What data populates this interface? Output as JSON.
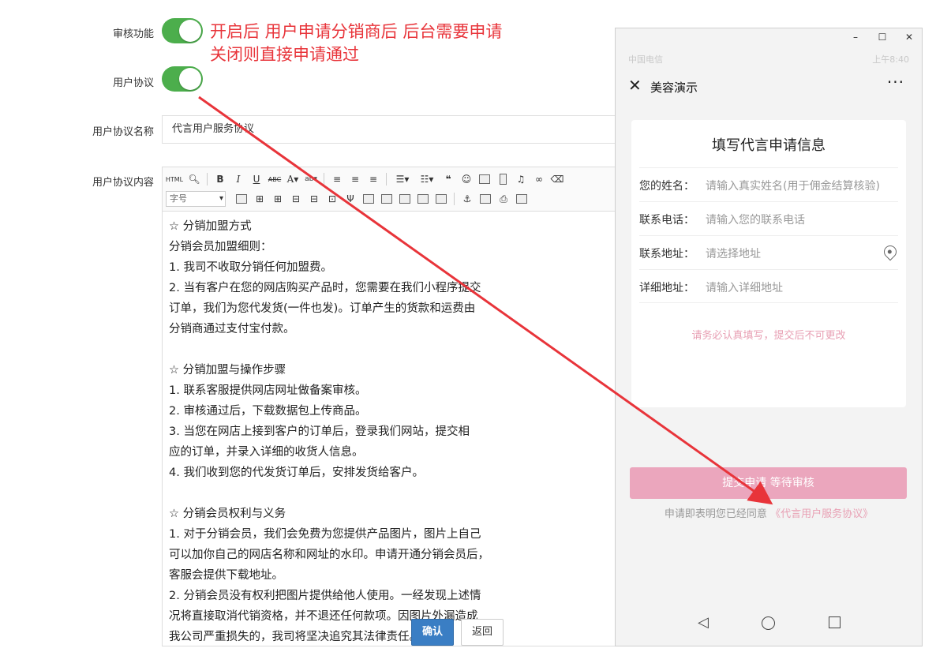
{
  "form": {
    "audit_label": "审核功能",
    "agreement_label": "用户协议",
    "agreement_name_label": "用户协议名称",
    "agreement_name_value": "代言用户服务协议",
    "agreement_content_label": "用户协议内容",
    "audit_enabled": true,
    "agreement_enabled": true
  },
  "annotation": {
    "line1": "开启后  用户申请分销商后  后台需要申请",
    "line2": "关闭则直接申请通过",
    "color": "#e8343a"
  },
  "editor": {
    "font_size_placeholder": "字号",
    "toolbar_row1": [
      "html-source",
      "find",
      "bold",
      "italic",
      "underline",
      "strikethrough",
      "font-color",
      "highlight",
      "align-left",
      "align-center",
      "align-right",
      "ordered-list",
      "unordered-list",
      "blockquote",
      "emoticon",
      "image",
      "video",
      "music",
      "link",
      "eraser"
    ],
    "toolbar_row2": [
      "font-size",
      "table",
      "insert-row",
      "insert-col",
      "delete-row",
      "delete-col",
      "merge",
      "split",
      "cell-a",
      "cell-b",
      "cell-c",
      "cell-d",
      "anchor",
      "map",
      "print",
      "preview"
    ],
    "content": [
      "   ☆ 分销加盟方式",
      "分销会员加盟细则：",
      "1. 我司不收取分销任何加盟费。",
      "2. 当有客户在您的网店购买产品时，您需要在我们小程序提交",
      "订单，我们为您代发货(一件也发)。订单产生的货款和运费由",
      "分销商通过支付宝付款。",
      "",
      "☆ 分销加盟与操作步骤",
      "1. 联系客服提供网店网址做备案审核。",
      "2. 审核通过后，下载数据包上传商品。",
      "3. 当您在网店上接到客户的订单后，登录我们网站，提交相",
      "应的订单，并录入详细的收货人信息。",
      "4. 我们收到您的代发货订单后，安排发货给客户。",
      "",
      "☆ 分销会员权利与义务",
      "1. 对于分销会员，我们会免费为您提供产品图片，图片上自己",
      "可以加你自己的网店名称和网址的水印。申请开通分销会员后，",
      "客服会提供下载地址。",
      "2. 分销会员没有权利把图片提供给他人使用。一经发现上述情",
      "况将直接取消代销资格，并不退还任何款项。因图片外漏造成",
      "我公司严重损失的，我司将坚决追究其法律责任。"
    ]
  },
  "actions": {
    "confirm": "确认",
    "back": "返回"
  },
  "phone": {
    "window_controls": [
      "–",
      "☐",
      "✕"
    ],
    "status_left": "中国电信",
    "status_right": "上午8:40",
    "nav_title": "美容演示",
    "card_title": "填写代言申请信息",
    "fields": [
      {
        "label": "您的姓名：",
        "placeholder": "请输入真实姓名(用于佣金结算核验)"
      },
      {
        "label": "联系电话：",
        "placeholder": "请输入您的联系电话"
      },
      {
        "label": "联系地址：",
        "placeholder": "请选择地址"
      },
      {
        "label": "详细地址：",
        "placeholder": "请输入详细地址"
      }
    ],
    "warning": "请务必认真填写，提交后不可更改",
    "submit": "提交申请 等待审核",
    "agree_prefix": "申请即表明您已经同意",
    "agree_link": "《代言用户服务协议》"
  },
  "colors": {
    "toggle_on": "#4cae4c",
    "arrow": "#e8343a",
    "submit_bg": "#eba6bd",
    "link_pink": "#e8a0b4",
    "confirm_bg": "#3a7ec4"
  }
}
